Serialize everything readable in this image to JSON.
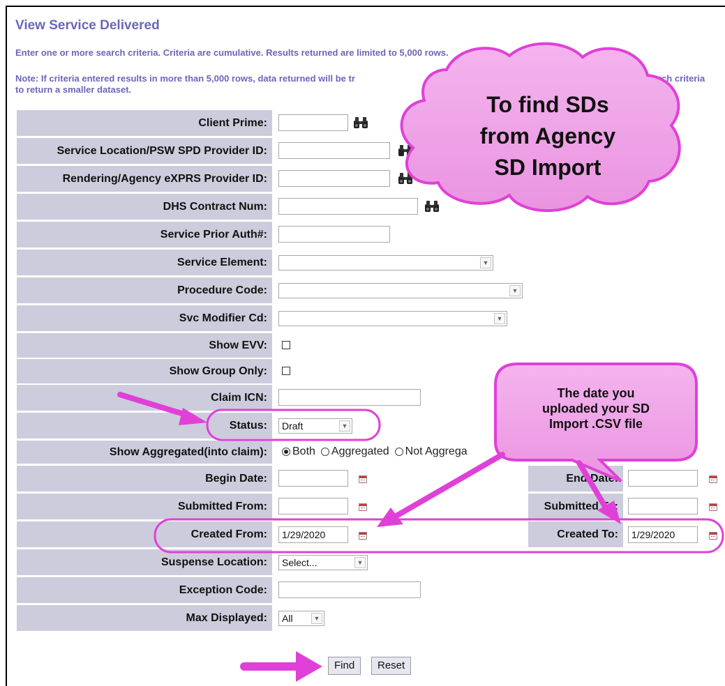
{
  "header": {
    "title": "View Service Delivered",
    "instructions": "Enter one or more search criteria. Criteria are cumulative. Results returned are limited to 5,000 rows.",
    "note_line1": "Note: If criteria entered results in more than 5,000 rows, data returned will be tr",
    "note_line1_tail": "rch criteria",
    "note_line2": "to return a smaller dataset."
  },
  "form": {
    "client_prime_label": "Client Prime:",
    "service_location_label": "Service Location/PSW SPD Provider ID:",
    "rendering_agency_label": "Rendering/Agency eXPRS Provider ID:",
    "dhs_contract_label": "DHS Contract Num:",
    "prior_auth_label": "Service Prior Auth#:",
    "service_element_label": "Service Element:",
    "procedure_code_label": "Procedure Code:",
    "svc_modifier_label": "Svc Modifier Cd:",
    "show_evv_label": "Show EVV:",
    "show_group_label": "Show Group Only:",
    "claim_icn_label": "Claim ICN:",
    "status_label": "Status:",
    "status_value": "Draft",
    "show_aggregated_label": "Show Aggregated(into claim):",
    "aggregated_options": [
      "Both",
      "Aggregated",
      "Not Aggrega"
    ],
    "aggregated_selected": "Both",
    "begin_date_label": "Begin Date:",
    "end_date_label": "End Date:",
    "submitted_from_label": "Submitted From:",
    "submitted_to_label": "Submitted To:",
    "created_from_label": "Created From:",
    "created_from_value": "1/29/2020",
    "created_to_label": "Created To:",
    "created_to_value": "1/29/2020",
    "suspense_location_label": "Suspense Location:",
    "suspense_location_value": "Select...",
    "exception_code_label": "Exception Code:",
    "max_displayed_label": "Max Displayed:",
    "max_displayed_value": "All"
  },
  "buttons": {
    "find": "Find",
    "reset": "Reset"
  },
  "annotations": {
    "cloud_line1": "To find SDs",
    "cloud_line2": "from Agency",
    "cloud_line3": "SD Import",
    "callout_line1": "The date you",
    "callout_line2": "uploaded your SD",
    "callout_line3": "Import .CSV file"
  },
  "colors": {
    "header_text": "#6b66b8",
    "label_bg": "#ccccdc",
    "annotation_magenta": "#e040d8",
    "callout_fill": "#f0a8e8"
  }
}
